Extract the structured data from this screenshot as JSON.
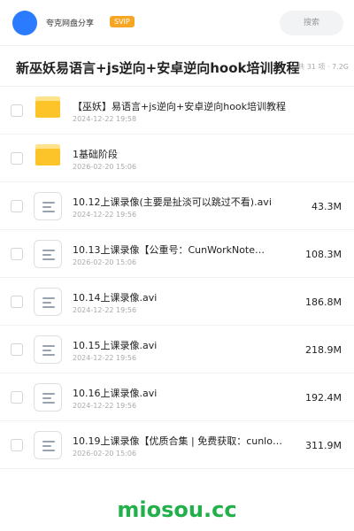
{
  "header": {
    "app_name": "夸克网盘分享",
    "badge": "SVIP",
    "search_placeholder": "搜索",
    "accent": "#2b7bff",
    "badge_color": "#f6a623"
  },
  "folder": {
    "title": "新巫妖易语言+js逆向+安卓逆向hook培训教程",
    "summary": "共 31 项 · 7.2G"
  },
  "files": [
    {
      "icon": "folder-icon",
      "name": "【巫妖】易语言+js逆向+安卓逆向hook培训教程",
      "date": "2024-12-22 19:58",
      "size": ""
    },
    {
      "icon": "folder-icon",
      "name": "1基础阶段",
      "date": "2026-02-20 15:06",
      "size": ""
    },
    {
      "icon": "file-icon",
      "name": "10.12上课录像(主要是扯淡可以跳过不看).avi",
      "date": "2024-12-22 19:56",
      "size": "43.3M"
    },
    {
      "icon": "file-icon",
      "name": "10.13上课录像【公重号：CunWorkNote…",
      "date": "2026-02-20 15:06",
      "size": "108.3M"
    },
    {
      "icon": "file-icon",
      "name": "10.14上课录像.avi",
      "date": "2024-12-22 19:56",
      "size": "186.8M"
    },
    {
      "icon": "file-icon",
      "name": "10.15上课录像.avi",
      "date": "2024-12-22 19:56",
      "size": "218.9M"
    },
    {
      "icon": "file-icon",
      "name": "10.16上课录像.avi",
      "date": "2024-12-22 19:56",
      "size": "192.4M"
    },
    {
      "icon": "file-icon",
      "name": "10.19上课录像【优质合集 | 免费获取：cunlo…",
      "date": "2026-02-20 15:06",
      "size": "311.9M"
    }
  ],
  "watermark": "miosou.cc"
}
